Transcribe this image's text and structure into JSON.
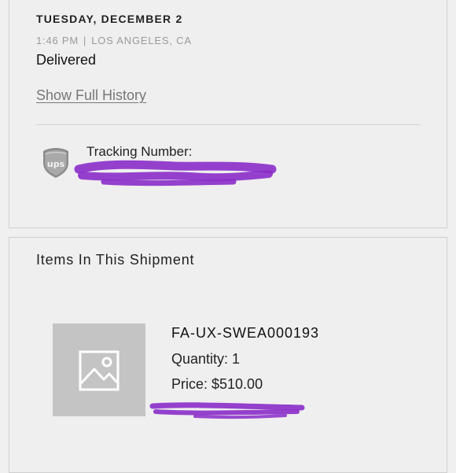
{
  "shipment_event": {
    "date": "TUESDAY, DECEMBER 2",
    "time": "1:46 PM",
    "separator": "|",
    "location": "LOS ANGELES, CA",
    "status": "Delivered"
  },
  "history_link": "Show Full History",
  "tracking": {
    "carrier_icon": "ups-logo-icon",
    "label": "Tracking Number:"
  },
  "items_section": {
    "title": "Items In This Shipment",
    "items": [
      {
        "image_icon": "image-placeholder-icon",
        "sku": "FA-UX-SWEA000193",
        "quantity_label": "Quantity: 1",
        "price_label": "Price: $510.00"
      }
    ]
  },
  "colors": {
    "redaction": "#8a2cc9",
    "link": "#777777",
    "muted": "#9a9a9a",
    "thumb_bg": "#c4c4c4"
  }
}
